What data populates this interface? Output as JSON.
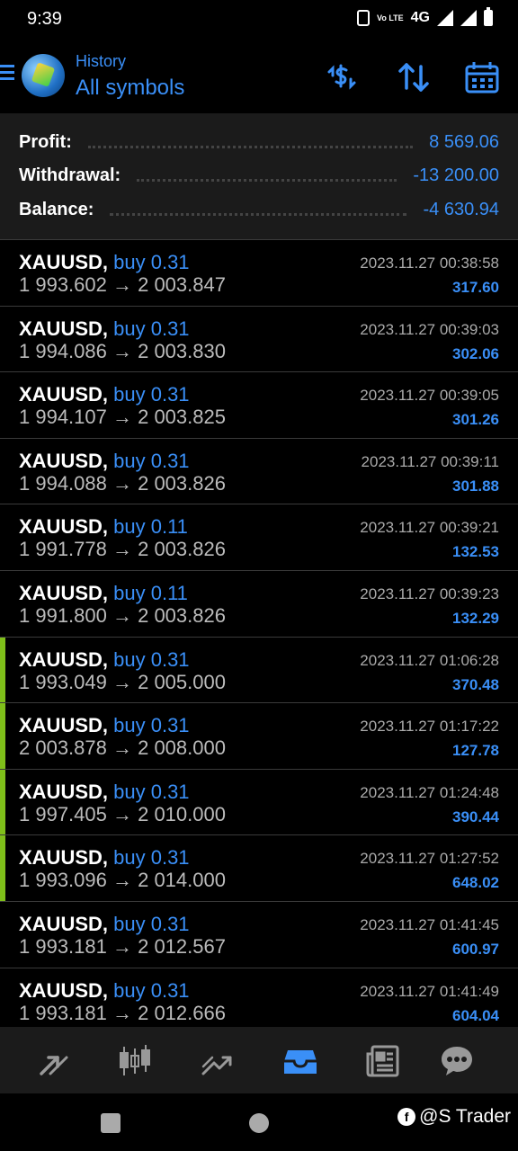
{
  "status": {
    "time": "9:39",
    "network": "4G",
    "volte": "Vo LTE"
  },
  "header": {
    "subtitle": "History",
    "title": "All symbols"
  },
  "summary": {
    "profit_label": "Profit:",
    "profit_value": "8 569.06",
    "withdrawal_label": "Withdrawal:",
    "withdrawal_value": "-13 200.00",
    "balance_label": "Balance:",
    "balance_value": "-4 630.94"
  },
  "deals": [
    {
      "symbol": "XAUUSD,",
      "side": "buy 0.31",
      "prices": "1 993.602 → 2 003.847",
      "time": "2023.11.27 00:38:58",
      "profit": "317.60",
      "marked": false
    },
    {
      "symbol": "XAUUSD,",
      "side": "buy 0.31",
      "prices": "1 994.086 → 2 003.830",
      "time": "2023.11.27 00:39:03",
      "profit": "302.06",
      "marked": false
    },
    {
      "symbol": "XAUUSD,",
      "side": "buy 0.31",
      "prices": "1 994.107 → 2 003.825",
      "time": "2023.11.27 00:39:05",
      "profit": "301.26",
      "marked": false
    },
    {
      "symbol": "XAUUSD,",
      "side": "buy 0.31",
      "prices": "1 994.088 → 2 003.826",
      "time": "2023.11.27 00:39:11",
      "profit": "301.88",
      "marked": false
    },
    {
      "symbol": "XAUUSD,",
      "side": "buy 0.11",
      "prices": "1 991.778 → 2 003.826",
      "time": "2023.11.27 00:39:21",
      "profit": "132.53",
      "marked": false
    },
    {
      "symbol": "XAUUSD,",
      "side": "buy 0.11",
      "prices": "1 991.800 → 2 003.826",
      "time": "2023.11.27 00:39:23",
      "profit": "132.29",
      "marked": false
    },
    {
      "symbol": "XAUUSD,",
      "side": "buy 0.31",
      "prices": "1 993.049 → 2 005.000",
      "time": "2023.11.27 01:06:28",
      "profit": "370.48",
      "marked": true
    },
    {
      "symbol": "XAUUSD,",
      "side": "buy 0.31",
      "prices": "2 003.878 → 2 008.000",
      "time": "2023.11.27 01:17:22",
      "profit": "127.78",
      "marked": true
    },
    {
      "symbol": "XAUUSD,",
      "side": "buy 0.31",
      "prices": "1 997.405 → 2 010.000",
      "time": "2023.11.27 01:24:48",
      "profit": "390.44",
      "marked": true
    },
    {
      "symbol": "XAUUSD,",
      "side": "buy 0.31",
      "prices": "1 993.096 → 2 014.000",
      "time": "2023.11.27 01:27:52",
      "profit": "648.02",
      "marked": true
    },
    {
      "symbol": "XAUUSD,",
      "side": "buy 0.31",
      "prices": "1 993.181 → 2 012.567",
      "time": "2023.11.27 01:41:45",
      "profit": "600.97",
      "marked": false
    },
    {
      "symbol": "XAUUSD,",
      "side": "buy 0.31",
      "prices": "1 993.181 → 2 012.666",
      "time": "2023.11.27 01:41:49",
      "profit": "604.04",
      "marked": false
    }
  ],
  "bottom_nav": {
    "items": [
      {
        "icon": "quotes-icon",
        "active": false
      },
      {
        "icon": "chart-icon",
        "active": false
      },
      {
        "icon": "trade-icon",
        "active": false
      },
      {
        "icon": "history-icon",
        "active": true
      },
      {
        "icon": "news-icon",
        "active": false
      },
      {
        "icon": "chat-icon",
        "active": false
      }
    ]
  },
  "watermark": "@S Trader",
  "colors": {
    "accent": "#3a8ff7",
    "marker": "#7fbf1a",
    "panel": "#1b1b1b"
  }
}
